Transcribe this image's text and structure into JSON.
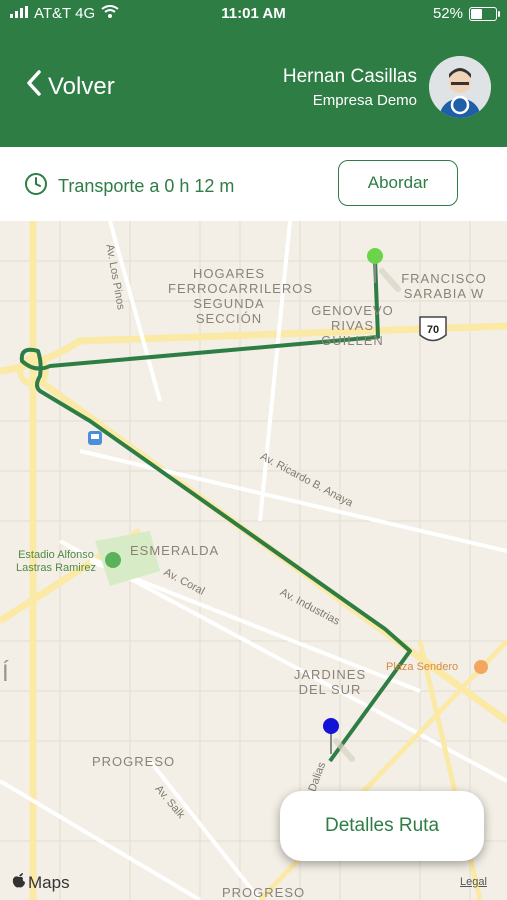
{
  "status_bar": {
    "carrier": "AT&T 4G",
    "time": "11:01 AM",
    "battery": "52%",
    "battery_level": 0.52
  },
  "header": {
    "back_label": "Volver",
    "user_name": "Hernan Casillas",
    "company": "Empresa Demo"
  },
  "trip": {
    "eta_text": "Transporte a 0 h 12 m",
    "board_label": "Abordar"
  },
  "map": {
    "areas": [
      "HOGARES FERROCARRILEROS SEGUNDA SECCIÓN",
      "FRANCISCO SARABIA W",
      "GENOVEVO RIVAS GUILLEN",
      "ESMERALDA",
      "JARDINES DEL SUR",
      "PROGRESO",
      "PROGRESO"
    ],
    "streets": [
      "Av. Los Pinos",
      "Av. Ricardo B. Anaya",
      "Av. Coral",
      "Av. Industrias",
      "Av. Salk",
      "Dalias"
    ],
    "places": [
      "Estadio Alfonso Lastras Ramirez",
      "Plaza Sendero"
    ],
    "highway": "70",
    "edge_letter": "Í",
    "route_color": "#2e7d45",
    "origin_pin_color": "#6bd44a",
    "destination_pin_color": "#1414d6"
  },
  "details_label": "Detalles Ruta",
  "maps_logo": "Maps",
  "legal": "Legal"
}
